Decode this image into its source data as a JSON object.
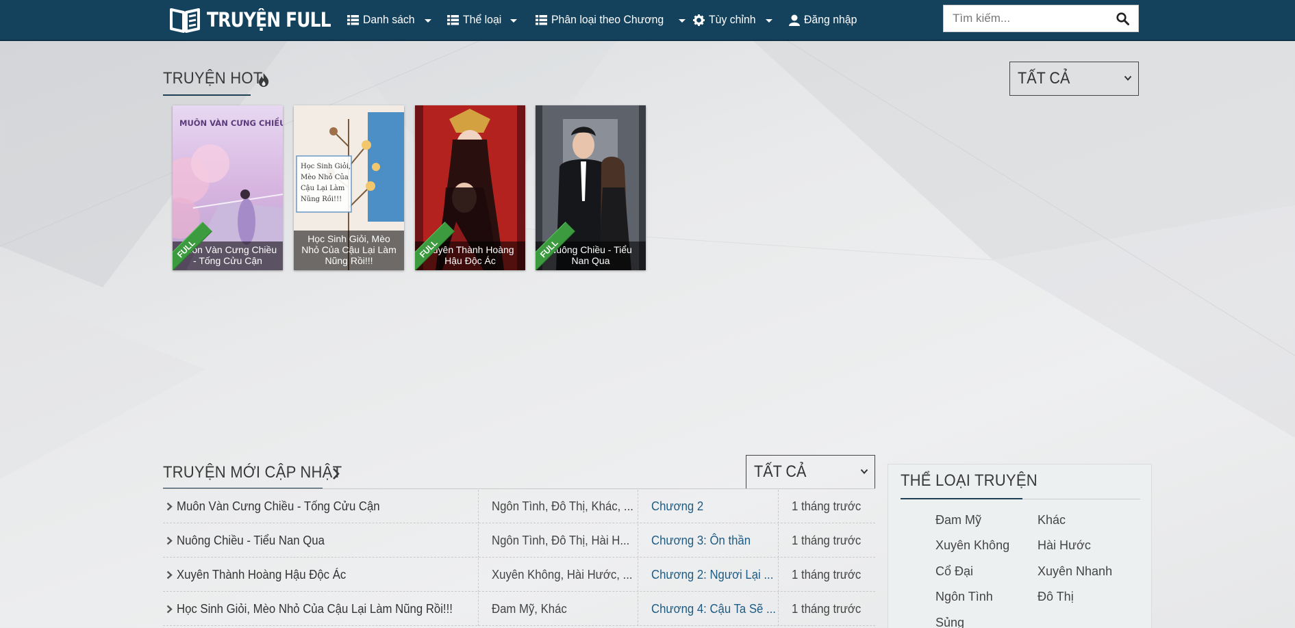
{
  "nav": {
    "brand": "TRUYỆN FULL",
    "items": [
      {
        "label": "Danh sách",
        "icon": "list-icon"
      },
      {
        "label": "Thể loại",
        "icon": "list-icon"
      },
      {
        "label": "Phân loại theo Chương",
        "icon": "list-icon"
      },
      {
        "label": "Tùy chỉnh",
        "icon": "gear-icon"
      },
      {
        "label": "Đăng nhập",
        "icon": "user-icon"
      }
    ],
    "search_placeholder": "Tìm kiếm..."
  },
  "hot": {
    "title": "TRUYỆN HOT",
    "filter": "TẤT CẢ",
    "cards": [
      {
        "title": "Muôn Vàn Cưng Chiều - Tống Cửu Cận",
        "badge": "FULL",
        "cover_text": "MUÔN VÀN CƯNG CHIỀU"
      },
      {
        "title": "Học Sinh Giỏi, Mèo Nhỏ Của Cậu Lại Làm Nũng Rồi!!!",
        "badge": "",
        "cover_text": "Học Sinh Giỏi, Mèo Nhỏ Của Cậu Lại Làm Nũng Rồi!!!"
      },
      {
        "title": "Xuyên Thành Hoàng Hậu Độc Ác",
        "badge": "FULL",
        "cover_text": ""
      },
      {
        "title": "Nuông Chiều - Tiểu Nan Qua",
        "badge": "FULL",
        "cover_text": ""
      }
    ]
  },
  "new": {
    "title": "TRUYỆN MỚI CẬP NHẬT",
    "filter": "TẤT CẢ",
    "rows": [
      {
        "title": "Muôn Vàn Cưng Chiều - Tống Cửu Cận",
        "genres": "Ngôn Tình, Đô Thị, Khác, ...",
        "chapter": "Chương 2",
        "time": "1 tháng trước"
      },
      {
        "title": "Nuông Chiều - Tiểu Nan Qua",
        "genres": "Ngôn Tình, Đô Thị, Hài H...",
        "chapter": "Chương 3: Ôn thần",
        "time": "1 tháng trước"
      },
      {
        "title": "Xuyên Thành Hoàng Hậu Độc Ác",
        "genres": "Xuyên Không, Hài Hước, ...",
        "chapter": "Chương 2: Ngươi Lại ...",
        "time": "1 tháng trước"
      },
      {
        "title": "Học Sinh Giỏi, Mèo Nhỏ Của Cậu Lại Làm Nũng Rồi!!!",
        "genres": "Đam Mỹ, Khác",
        "chapter": "Chương 4: Cậu Ta Sẽ ...",
        "time": "1 tháng trước"
      }
    ]
  },
  "sidebar": {
    "title": "THỂ LOẠI TRUYỆN",
    "genres": [
      "Đam Mỹ",
      "Khác",
      "Xuyên Không",
      "Hài Hước",
      "Cổ Đại",
      "Xuyên Nhanh",
      "Ngôn Tình",
      "Đô Thị",
      "Sủng"
    ]
  },
  "colors": {
    "navbar": "#14425d",
    "chapter_link": "#1e5b83",
    "full_badge": "#3b9b3e"
  }
}
